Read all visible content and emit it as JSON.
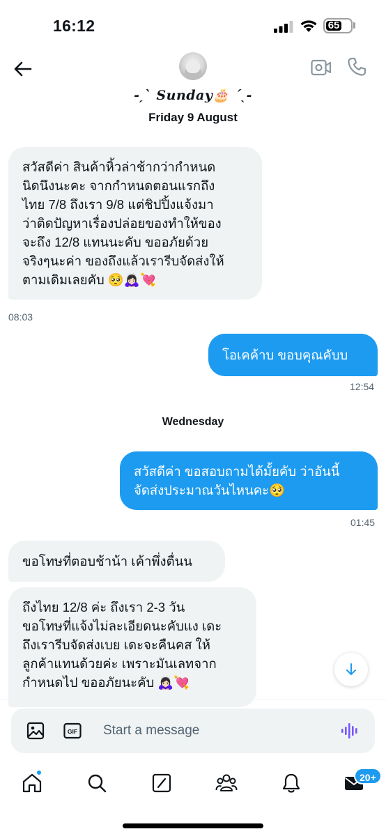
{
  "status_bar": {
    "time": "16:12",
    "battery": "65"
  },
  "header": {
    "contact_name": "-ˏˋ Sunday🎂 ˊˎ-",
    "date": "Friday 9 August"
  },
  "messages": [
    {
      "direction": "incoming",
      "lines": [
        "สวัสดีค่า สินค้าหิ้วล่าช้ากว่ากำหนด",
        "นิดนึงนะคะ จากกำหนดตอนแรกถึง",
        "ไทย 7/8 ถึงเรา 9/8 แต่ชิปปิ้งแจ้งมา",
        "ว่าติดปัญหาเรื่องปล่อยของทำให้ของ",
        "จะถึง 12/8 แทนนะคับ ขออภัยด้วย",
        "จริงๆนะค่า ของถึงแล้วเรารีบจัดส่งให้",
        "ตามเดิมเลยคับ 🥺🙇🏻‍♀️💘"
      ],
      "time": "08:03"
    },
    {
      "direction": "outgoing",
      "lines": [
        "โอเคค้าบ ขอบคุณคับบ"
      ],
      "time": "12:54"
    },
    {
      "direction": "outgoing",
      "lines": [
        "สวัสดีค่า ขอสอบถามได้มั้ยคับ ว่าอันนี้",
        "จัดส่งประมาณวันไหนคะ🥺"
      ],
      "time": "01:45"
    },
    {
      "direction": "incoming",
      "lines": [
        "ขอโทษที่ตอบช้าน้า เค้าพึ่งตื่นน"
      ]
    },
    {
      "direction": "incoming",
      "lines": [
        "ถึงไทย 12/8 ค่ะ ถึงเรา 2-3 วัน",
        "ขอโทษที่แจ้งไม่ละเอียดนะคับแง เดะ",
        "ถึงเรารีบจัดส่งเบย เดะจะคืนคส ให้",
        "ลูกค้าแทนด้วยค่ะ เพราะมันเลทจาก",
        "กำหนดไป ขออภัยนะคับ 🙇🏻‍♀️💘"
      ]
    }
  ],
  "day_separator": "Wednesday",
  "composer": {
    "placeholder": "Start a message"
  },
  "nav": {
    "badge": "20+"
  },
  "colors": {
    "accent": "#1d9bf0",
    "incoming_bg": "#eff3f4",
    "text_secondary": "#536471"
  },
  "icons": [
    "back-arrow-icon",
    "video-call-icon",
    "phone-icon",
    "image-icon",
    "gif-icon",
    "voice-icon",
    "home-icon",
    "search-icon",
    "grok-icon",
    "communities-icon",
    "notifications-icon",
    "messages-icon",
    "arrow-down-icon"
  ]
}
